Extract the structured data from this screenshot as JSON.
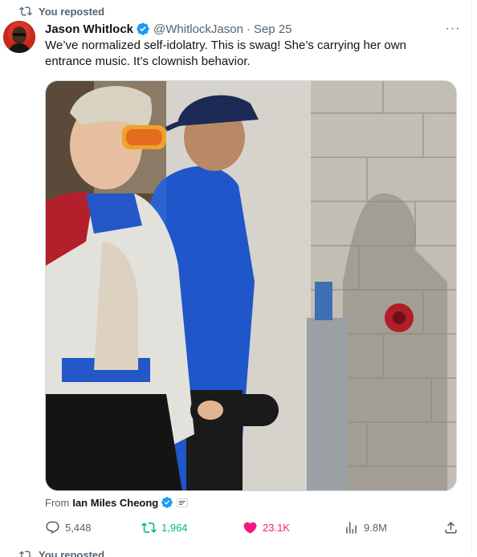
{
  "repost_banner": {
    "icon": "repost-icon",
    "label": "You reposted"
  },
  "author": {
    "name": "Jason Whitlock",
    "handle": "@WhitlockJason",
    "separator": "·",
    "date": "Sep 25",
    "verified_color": "#1d9bf0"
  },
  "more_label": "···",
  "tweet": {
    "text": "We’ve normalized self-idolatry. This is swag! She’s carrying her own entrance music. It’s clownish behavior."
  },
  "media": {
    "type": "video"
  },
  "attribution": {
    "prefix": "From",
    "name": "Ian Miles Cheong"
  },
  "actions": {
    "replies": "5,448",
    "reposts": "1,964",
    "likes": "23.1K",
    "views": "9.8M"
  },
  "colors": {
    "accent": "#1d9bf0",
    "repost_green": "#00ba7c",
    "like_pink": "#f91880",
    "muted": "#536471"
  },
  "next_tweet": {
    "label": "You reposted"
  }
}
